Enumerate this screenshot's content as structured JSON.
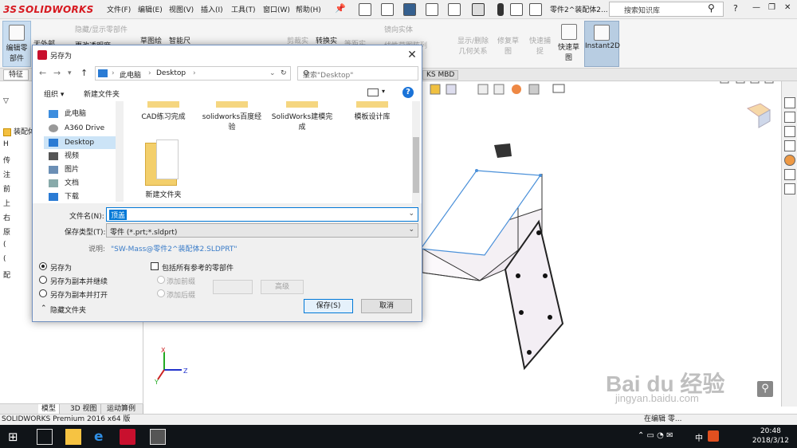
{
  "app": {
    "logo_text": "SOLIDWORKS",
    "menus": [
      "文件(F)",
      "编辑(E)",
      "视图(V)",
      "插入(I)",
      "工具(T)",
      "窗口(W)",
      "帮助(H)"
    ],
    "doc_title": "零件2^装配体2...",
    "search_placeholder": "搜索知识库",
    "help_label": "?",
    "minimize_label": "—",
    "restore_label": "❐",
    "close_label": "✕"
  },
  "ribbon": {
    "edit_part": [
      "编辑零",
      "部件"
    ],
    "no_ext": "无外部",
    "hide_show": "隐藏/显示零部件",
    "change_transparency": "更改透明度",
    "sketch_draw": "草图绘",
    "smart_dim": "智能尺",
    "show_delete": "显示/删除",
    "show_delete2": "几何关系",
    "repair_sketch": "修复草",
    "repair_sketch2": "图",
    "quick_snap": "快速捕",
    "quick_snap2": "捉",
    "rapid_sketch": "快速草",
    "rapid_sketch2": "图",
    "instant2d": "Instant2D",
    "mirror": "镜向实体",
    "linear_array": "线性草图阵列",
    "cut_entity": "剪裁实",
    "convert": "转换实",
    "equal_offset": "等距实"
  },
  "tabs": {
    "feature": "特征",
    "mbd": "KS MBD"
  },
  "featuremanager": {
    "rows": [
      "装配体",
      "H",
      "传",
      "注",
      "前",
      "上",
      "右",
      "原",
      "(",
      "(",
      "配"
    ]
  },
  "bottom_tabs": [
    "模型",
    "3D 视图",
    "运动算例 1"
  ],
  "status": {
    "left": "SOLIDWORKS Premium 2016 x64 版",
    "right_text": "在编辑 零..."
  },
  "clock": {
    "time": "20:48",
    "date": "2018/3/12",
    "ime": "中"
  },
  "dialog": {
    "title": "另存为",
    "breadcrumb": [
      "此电脑",
      "Desktop"
    ],
    "search_placeholder": "搜索\"Desktop\"",
    "organize": "组织 ▾",
    "new_folder_cmd": "新建文件夹",
    "nav_items": [
      "此电脑",
      "A360 Drive",
      "Desktop",
      "视频",
      "图片",
      "文档",
      "下载"
    ],
    "files": [
      {
        "name": "CAD练习完成"
      },
      {
        "name": "solidworks百度经验"
      },
      {
        "name": "SolidWorks建模完成"
      },
      {
        "name": "模板设计库"
      },
      {
        "name": "新建文件夹"
      }
    ],
    "filename_label": "文件名(N):",
    "filename_value": "顶盖",
    "savetype_label": "保存类型(T):",
    "savetype_value": "零件 (*.prt;*.sldprt)",
    "desc_label": "说明:",
    "desc_value": "\"SW-Mass@零件2^装配体2.SLDPRT\"",
    "radio_save_as": "另存为",
    "radio_copy_continue": "另存为副本并继续",
    "radio_copy_open": "另存为副本并打开",
    "include_refs": "包括所有参考的零部件",
    "add_prefix": "添加前缀",
    "add_suffix": "添加后缀",
    "advanced": "高级",
    "hide_folders": "隐藏文件夹",
    "save_btn": "保存(S)",
    "cancel_btn": "取消"
  },
  "watermark": {
    "brand": "Bai du 经验",
    "url": "jingyan.baidu.com"
  },
  "colors": {
    "accent": "#0078d7",
    "sw_red": "#d71920",
    "selection": "#cce4f7",
    "model_edge": "#4a90d9"
  }
}
